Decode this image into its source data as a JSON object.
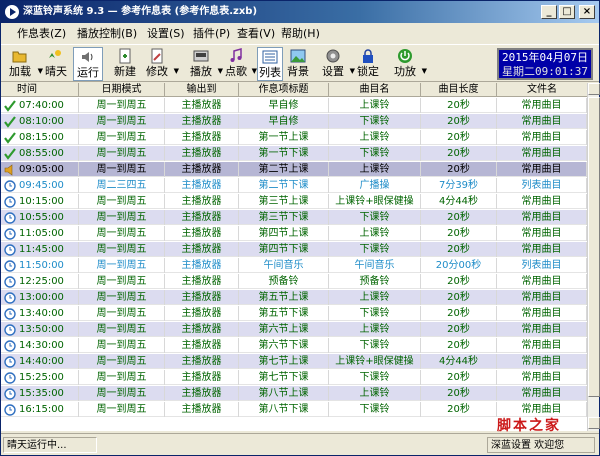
{
  "window": {
    "title": "深蓝铃声系统 9.3 — 参考作息表 (参考作息表.zxb)"
  },
  "menu": [
    {
      "label": "作息表(Z)"
    },
    {
      "label": "播放控制(B)"
    },
    {
      "label": "设置(S)"
    },
    {
      "label": "插件(P)"
    },
    {
      "label": "查看(V)"
    },
    {
      "label": "帮助(H)"
    }
  ],
  "toolbar": {
    "load": "加载",
    "sunny": "晴天",
    "run": "运行",
    "new": "新建",
    "edit": "修改",
    "play": "播放",
    "song": "点歌",
    "list": "列表",
    "background": "背景",
    "settings": "设置",
    "lock": "锁定",
    "power": "功放"
  },
  "clock": {
    "date": "2015年04月07日",
    "time": "星期二09:01:37"
  },
  "table": {
    "headers": [
      "时间",
      "日期模式",
      "输出到",
      "作息项标题",
      "曲目名",
      "曲目长度",
      "文件名"
    ],
    "rows": [
      {
        "icon": "check",
        "style": "",
        "cells": [
          "07:40:00",
          "周一到周五",
          "主播放器",
          "早自修",
          "上课铃",
          "20秒",
          "常用曲目"
        ]
      },
      {
        "icon": "check",
        "style": "alt",
        "cells": [
          "08:10:00",
          "周一到周五",
          "主播放器",
          "早自修",
          "下课铃",
          "20秒",
          "常用曲目"
        ]
      },
      {
        "icon": "check",
        "style": "",
        "cells": [
          "08:15:00",
          "周一到周五",
          "主播放器",
          "第一节上课",
          "上课铃",
          "20秒",
          "常用曲目"
        ]
      },
      {
        "icon": "check",
        "style": "alt",
        "cells": [
          "08:55:00",
          "周一到周五",
          "主播放器",
          "第一节下课",
          "下课铃",
          "20秒",
          "常用曲目"
        ]
      },
      {
        "icon": "speaker",
        "style": "playing",
        "cells": [
          "09:05:00",
          "周一到周五",
          "主播放器",
          "第二节上课",
          "上课铃",
          "20秒",
          "常用曲目"
        ]
      },
      {
        "icon": "clock",
        "style": "blue",
        "cells": [
          "09:45:00",
          "周二三四五",
          "主播放器",
          "第二节下课",
          "广播操",
          "7分39秒",
          "列表曲目"
        ]
      },
      {
        "icon": "clock",
        "style": "",
        "cells": [
          "10:15:00",
          "周一到周五",
          "主播放器",
          "第三节上课",
          "上课铃+眼保健操",
          "4分44秒",
          "常用曲目"
        ]
      },
      {
        "icon": "clock",
        "style": "alt",
        "cells": [
          "10:55:00",
          "周一到周五",
          "主播放器",
          "第三节下课",
          "下课铃",
          "20秒",
          "常用曲目"
        ]
      },
      {
        "icon": "clock",
        "style": "",
        "cells": [
          "11:05:00",
          "周一到周五",
          "主播放器",
          "第四节上课",
          "上课铃",
          "20秒",
          "常用曲目"
        ]
      },
      {
        "icon": "clock",
        "style": "alt",
        "cells": [
          "11:45:00",
          "周一到周五",
          "主播放器",
          "第四节下课",
          "下课铃",
          "20秒",
          "常用曲目"
        ]
      },
      {
        "icon": "clock",
        "style": "blue",
        "cells": [
          "11:50:00",
          "周一到周五",
          "主播放器",
          "午间音乐",
          "午间音乐",
          "20分00秒",
          "列表曲目"
        ]
      },
      {
        "icon": "clock",
        "style": "",
        "cells": [
          "12:25:00",
          "周一到周五",
          "主播放器",
          "预备铃",
          "预备铃",
          "20秒",
          "常用曲目"
        ]
      },
      {
        "icon": "clock",
        "style": "alt",
        "cells": [
          "13:00:00",
          "周一到周五",
          "主播放器",
          "第五节上课",
          "上课铃",
          "20秒",
          "常用曲目"
        ]
      },
      {
        "icon": "clock",
        "style": "",
        "cells": [
          "13:40:00",
          "周一到周五",
          "主播放器",
          "第五节下课",
          "下课铃",
          "20秒",
          "常用曲目"
        ]
      },
      {
        "icon": "clock",
        "style": "alt",
        "cells": [
          "13:50:00",
          "周一到周五",
          "主播放器",
          "第六节上课",
          "上课铃",
          "20秒",
          "常用曲目"
        ]
      },
      {
        "icon": "clock",
        "style": "",
        "cells": [
          "14:30:00",
          "周一到周五",
          "主播放器",
          "第六节下课",
          "下课铃",
          "20秒",
          "常用曲目"
        ]
      },
      {
        "icon": "clock",
        "style": "alt",
        "cells": [
          "14:40:00",
          "周一到周五",
          "主播放器",
          "第七节上课",
          "上课铃+眼保健操",
          "4分44秒",
          "常用曲目"
        ]
      },
      {
        "icon": "clock",
        "style": "",
        "cells": [
          "15:25:00",
          "周一到周五",
          "主播放器",
          "第七节下课",
          "下课铃",
          "20秒",
          "常用曲目"
        ]
      },
      {
        "icon": "clock",
        "style": "alt",
        "cells": [
          "15:35:00",
          "周一到周五",
          "主播放器",
          "第八节上课",
          "上课铃",
          "20秒",
          "常用曲目"
        ]
      },
      {
        "icon": "clock",
        "style": "",
        "cells": [
          "16:15:00",
          "周一到周五",
          "主播放器",
          "第八节下课",
          "下课铃",
          "20秒",
          "常用曲目"
        ]
      }
    ]
  },
  "status": {
    "left": "晴天运行中...",
    "right": "深蓝设置 欢迎您"
  },
  "watermark": "脚本之家",
  "colors": {
    "title_bar": "#0a246a",
    "row_text": "#006400",
    "row_text_list": "#1e8cc8",
    "row_alt": "#dcdcf0",
    "row_playing": "#b6b6d4",
    "clock_bg": "#0000a8"
  }
}
